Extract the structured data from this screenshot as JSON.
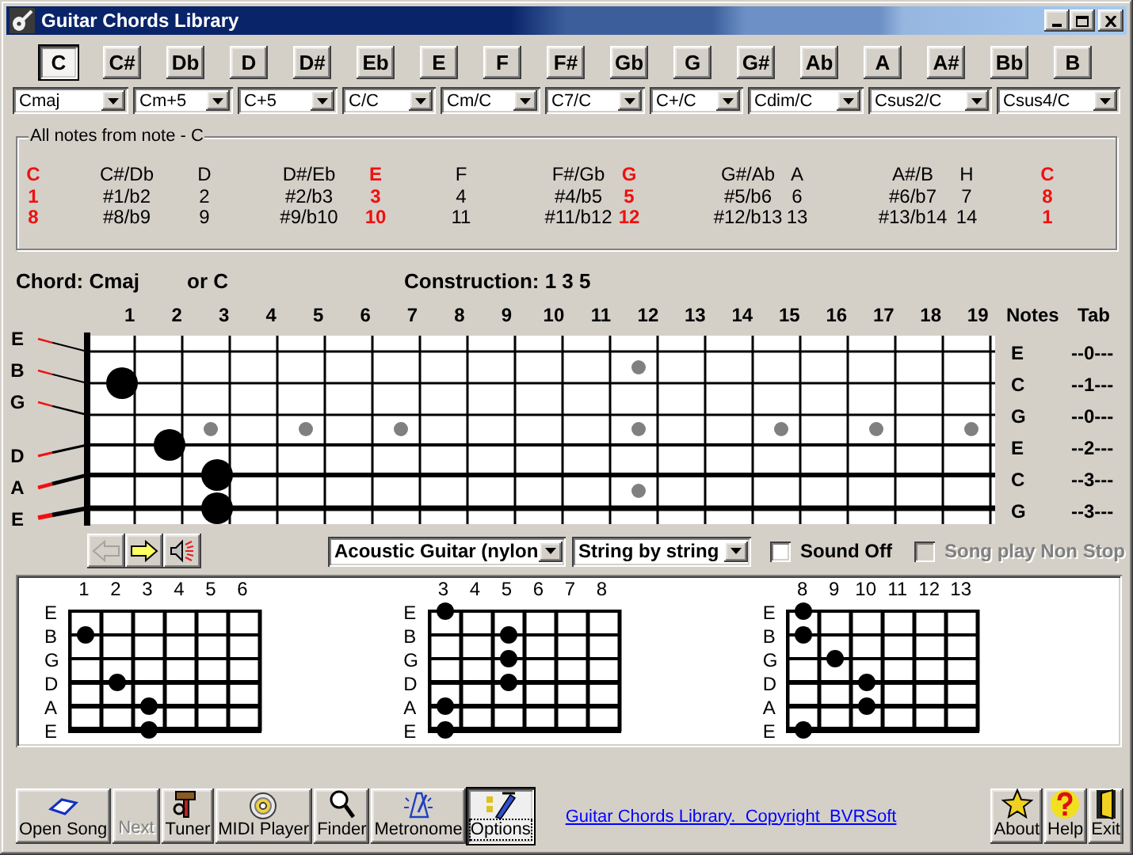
{
  "window": {
    "title": "Guitar Chords Library"
  },
  "root_notes": [
    {
      "label": "C",
      "selected": true
    },
    {
      "label": "C#",
      "selected": false
    },
    {
      "label": "Db",
      "selected": false
    },
    {
      "label": "D",
      "selected": false
    },
    {
      "label": "D#",
      "selected": false
    },
    {
      "label": "Eb",
      "selected": false
    },
    {
      "label": "E",
      "selected": false
    },
    {
      "label": "F",
      "selected": false
    },
    {
      "label": "F#",
      "selected": false
    },
    {
      "label": "Gb",
      "selected": false
    },
    {
      "label": "G",
      "selected": false
    },
    {
      "label": "G#",
      "selected": false
    },
    {
      "label": "Ab",
      "selected": false
    },
    {
      "label": "A",
      "selected": false
    },
    {
      "label": "A#",
      "selected": false
    },
    {
      "label": "Bb",
      "selected": false
    },
    {
      "label": "B",
      "selected": false
    }
  ],
  "chord_types": [
    "Cmaj",
    "Cm+5",
    "C+5",
    "C/C",
    "Cm/C",
    "C7/C",
    "C+/C",
    "Cdim/C",
    "Csus2/C",
    "Csus4/C"
  ],
  "notes_panel": {
    "title": "All notes from note - C",
    "columns": [
      {
        "note": "C",
        "degree": "1",
        "extended": "8",
        "highlight": true
      },
      {
        "note": "C#/Db",
        "degree": "#1/b2",
        "extended": "#8/b9",
        "highlight": false
      },
      {
        "note": "D",
        "degree": "2",
        "extended": "9",
        "highlight": false
      },
      {
        "note": "D#/Eb",
        "degree": "#2/b3",
        "extended": "#9/b10",
        "highlight": false
      },
      {
        "note": "E",
        "degree": "3",
        "extended": "10",
        "highlight": true
      },
      {
        "note": "F",
        "degree": "4",
        "extended": "11",
        "highlight": false
      },
      {
        "note": "F#/Gb",
        "degree": "#4/b5",
        "extended": "#11/b12",
        "highlight": false
      },
      {
        "note": "G",
        "degree": "5",
        "extended": "12",
        "highlight": true
      },
      {
        "note": "G#/Ab",
        "degree": "#5/b6",
        "extended": "#12/b13",
        "highlight": false
      },
      {
        "note": "A",
        "degree": "6",
        "extended": "13",
        "highlight": false
      },
      {
        "note": "A#/B",
        "degree": "#6/b7",
        "extended": "#13/b14",
        "highlight": false
      },
      {
        "note": "H",
        "degree": "7",
        "extended": "14",
        "highlight": false
      },
      {
        "note": "C",
        "degree": "8",
        "extended": "1",
        "highlight": true
      }
    ]
  },
  "chord": {
    "name": "Chord: Cmaj",
    "alias": "or C",
    "construction": "Construction: 1 3 5"
  },
  "fretboard": {
    "fret_numbers": [
      "1",
      "2",
      "3",
      "4",
      "5",
      "6",
      "7",
      "8",
      "9",
      "10",
      "11",
      "12",
      "13",
      "14",
      "15",
      "16",
      "17",
      "18",
      "19"
    ],
    "notes_heading": "Notes",
    "tab_heading": "Tab",
    "strings": [
      {
        "label": "E",
        "note": "E",
        "tab": "--0---",
        "pressed": [
          false,
          false,
          false,
          false,
          false,
          false,
          false,
          false,
          false,
          false,
          false,
          false,
          false,
          false,
          false,
          false,
          false,
          false,
          false
        ]
      },
      {
        "label": "B",
        "note": "C",
        "tab": "--1---",
        "pressed": [
          true,
          false,
          false,
          false,
          false,
          false,
          false,
          false,
          false,
          false,
          false,
          false,
          false,
          false,
          false,
          false,
          false,
          false,
          false
        ]
      },
      {
        "label": "G",
        "note": "G",
        "tab": "--0---",
        "pressed": [
          false,
          false,
          false,
          false,
          false,
          false,
          false,
          false,
          false,
          false,
          false,
          false,
          false,
          false,
          false,
          false,
          false,
          false,
          false
        ]
      },
      {
        "label": "D",
        "note": "E",
        "tab": "--2---",
        "pressed": [
          false,
          true,
          false,
          false,
          false,
          false,
          false,
          false,
          false,
          false,
          false,
          false,
          false,
          false,
          false,
          false,
          false,
          false,
          false
        ]
      },
      {
        "label": "A",
        "note": "C",
        "tab": "--3---",
        "pressed": [
          false,
          false,
          true,
          false,
          false,
          false,
          false,
          false,
          false,
          false,
          false,
          false,
          false,
          false,
          false,
          false,
          false,
          false,
          false
        ]
      },
      {
        "label": "E",
        "note": "G",
        "tab": "--3---",
        "pressed": [
          false,
          false,
          true,
          false,
          false,
          false,
          false,
          false,
          false,
          false,
          false,
          false,
          false,
          false,
          false,
          false,
          false,
          false,
          false
        ]
      }
    ]
  },
  "playback": {
    "buttons": [
      {
        "kind": "previous",
        "disabled": true
      },
      {
        "kind": "next",
        "disabled": false
      },
      {
        "kind": "sound",
        "disabled": false
      }
    ],
    "instrument": "Acoustic Guitar (nylon",
    "mode": "String by string",
    "sound_off": {
      "label": "Sound Off",
      "checked": false,
      "disabled": false
    },
    "non_stop": {
      "label": "Song play Non Stop",
      "checked": false,
      "disabled": true
    }
  },
  "diagrams": [
    {
      "frets": [
        "1",
        "2",
        "3",
        "4",
        "5",
        "6"
      ],
      "strings": [
        {
          "label": "E",
          "pressed": [
            false,
            false,
            false,
            false,
            false,
            false
          ]
        },
        {
          "label": "B",
          "pressed": [
            true,
            false,
            false,
            false,
            false,
            false
          ]
        },
        {
          "label": "G",
          "pressed": [
            false,
            false,
            false,
            false,
            false,
            false
          ]
        },
        {
          "label": "D",
          "pressed": [
            false,
            true,
            false,
            false,
            false,
            false
          ]
        },
        {
          "label": "A",
          "pressed": [
            false,
            false,
            true,
            false,
            false,
            false
          ]
        },
        {
          "label": "E",
          "pressed": [
            false,
            false,
            true,
            false,
            false,
            false
          ]
        }
      ]
    },
    {
      "frets": [
        "3",
        "4",
        "5",
        "6",
        "7",
        "8"
      ],
      "strings": [
        {
          "label": "E",
          "pressed": [
            true,
            false,
            false,
            false,
            false,
            false
          ]
        },
        {
          "label": "B",
          "pressed": [
            false,
            false,
            true,
            false,
            false,
            false
          ]
        },
        {
          "label": "G",
          "pressed": [
            false,
            false,
            true,
            false,
            false,
            false
          ]
        },
        {
          "label": "D",
          "pressed": [
            false,
            false,
            true,
            false,
            false,
            false
          ]
        },
        {
          "label": "A",
          "pressed": [
            true,
            false,
            false,
            false,
            false,
            false
          ]
        },
        {
          "label": "E",
          "pressed": [
            true,
            false,
            false,
            false,
            false,
            false
          ]
        }
      ]
    },
    {
      "frets": [
        "8",
        "9",
        "10",
        "11",
        "12",
        "13"
      ],
      "strings": [
        {
          "label": "E",
          "pressed": [
            true,
            false,
            false,
            false,
            false,
            false
          ]
        },
        {
          "label": "B",
          "pressed": [
            true,
            false,
            false,
            false,
            false,
            false
          ]
        },
        {
          "label": "G",
          "pressed": [
            false,
            true,
            false,
            false,
            false,
            false
          ]
        },
        {
          "label": "D",
          "pressed": [
            false,
            false,
            true,
            false,
            false,
            false
          ]
        },
        {
          "label": "A",
          "pressed": [
            false,
            false,
            true,
            false,
            false,
            false
          ]
        },
        {
          "label": "E",
          "pressed": [
            true,
            false,
            false,
            false,
            false,
            false
          ]
        }
      ]
    }
  ],
  "toolbar": {
    "buttons": [
      {
        "label": "Open Song",
        "kind": "open",
        "disabled": false,
        "pressed": false
      },
      {
        "label": "Next",
        "kind": "next",
        "disabled": true,
        "pressed": false
      },
      {
        "label": "Tuner",
        "kind": "tuner",
        "disabled": false,
        "pressed": false
      },
      {
        "label": "MIDI Player",
        "kind": "midi",
        "disabled": false,
        "pressed": false
      },
      {
        "label": "Finder",
        "kind": "finder",
        "disabled": false,
        "pressed": false
      },
      {
        "label": "Metronome",
        "kind": "metronome",
        "disabled": false,
        "pressed": false
      },
      {
        "label": "Options",
        "kind": "options",
        "disabled": false,
        "pressed": true
      }
    ],
    "link": "Guitar Chords Library.  Copyright  BVRSoft",
    "right_buttons": [
      {
        "label": "About",
        "kind": "about",
        "disabled": false,
        "pressed": false
      },
      {
        "label": "Help",
        "kind": "help",
        "disabled": false,
        "pressed": false
      },
      {
        "label": "Exit",
        "kind": "exit",
        "disabled": false,
        "pressed": false
      }
    ]
  }
}
